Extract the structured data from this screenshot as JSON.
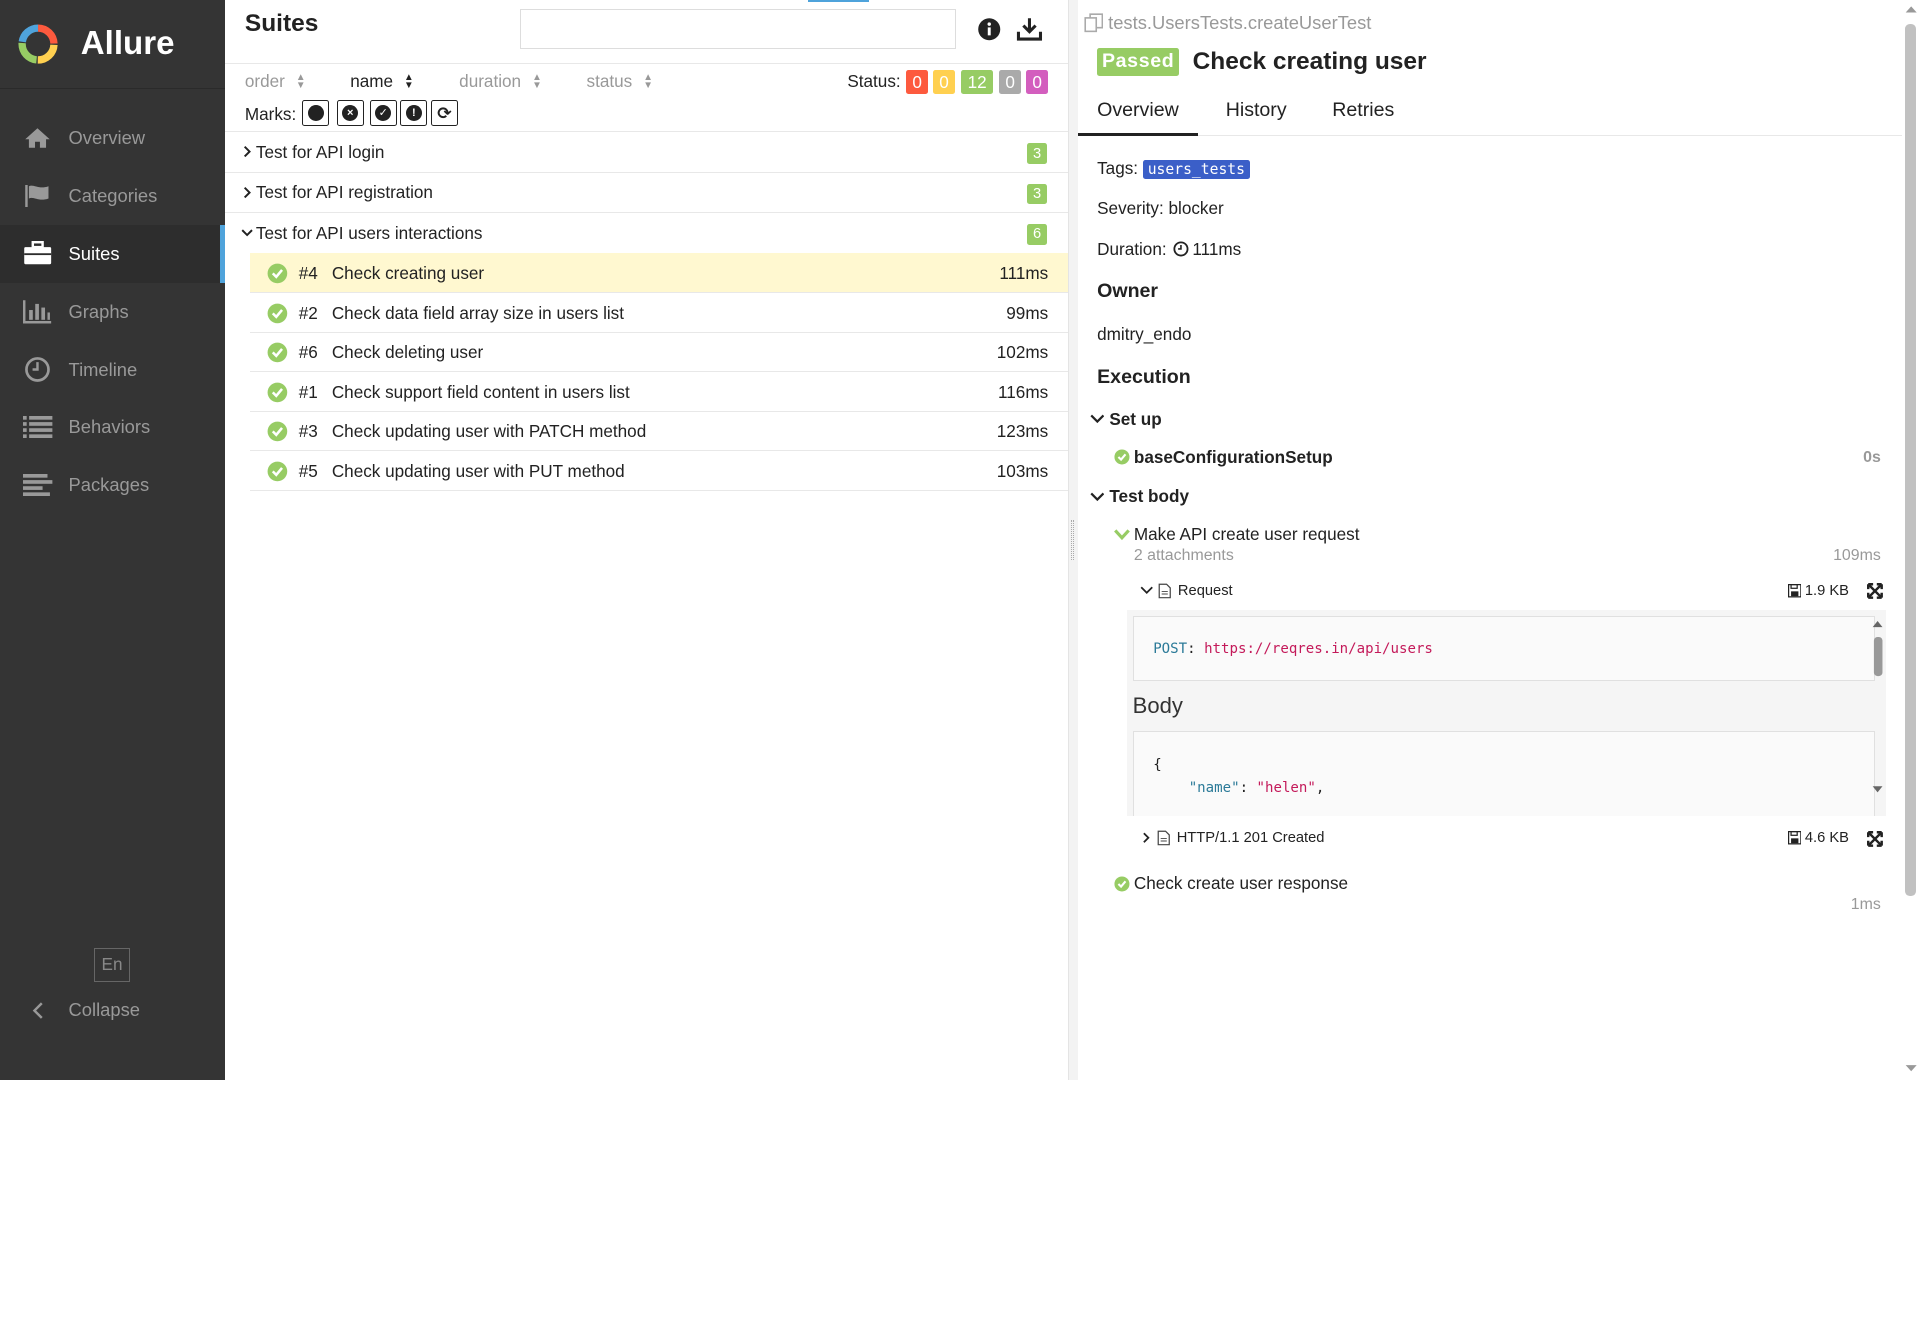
{
  "app": {
    "name": "Allure"
  },
  "sidebar": {
    "items": [
      {
        "label": "Overview",
        "icon": "home-icon"
      },
      {
        "label": "Categories",
        "icon": "flag-icon"
      },
      {
        "label": "Suites",
        "icon": "briefcase-icon",
        "active": true
      },
      {
        "label": "Graphs",
        "icon": "bar-chart-icon"
      },
      {
        "label": "Timeline",
        "icon": "clock-icon"
      },
      {
        "label": "Behaviors",
        "icon": "list-icon"
      },
      {
        "label": "Packages",
        "icon": "align-left-icon"
      }
    ],
    "language": "En",
    "collapse_label": "Collapse"
  },
  "suites": {
    "title": "Suites",
    "search_value": "",
    "sort": {
      "order": "order",
      "name": "name",
      "duration": "duration",
      "status": "status"
    },
    "status_label": "Status:",
    "status_counts": {
      "failed": "0",
      "broken": "0",
      "passed": "12",
      "skipped": "0",
      "unknown": "0"
    },
    "marks_label": "Marks:",
    "groups": [
      {
        "name": "Test for API login",
        "count": "3",
        "expanded": false
      },
      {
        "name": "Test for API registration",
        "count": "3",
        "expanded": false
      },
      {
        "name": "Test for API users interactions",
        "count": "6",
        "expanded": true
      }
    ],
    "tests": [
      {
        "num": "#4",
        "name": "Check creating user",
        "duration": "111ms",
        "selected": true
      },
      {
        "num": "#2",
        "name": "Check data field array size in users list",
        "duration": "99ms"
      },
      {
        "num": "#6",
        "name": "Check deleting user",
        "duration": "102ms"
      },
      {
        "num": "#1",
        "name": "Check support field content in users list",
        "duration": "116ms"
      },
      {
        "num": "#3",
        "name": "Check updating user with PATCH method",
        "duration": "123ms"
      },
      {
        "num": "#5",
        "name": "Check updating user with PUT method",
        "duration": "103ms"
      }
    ]
  },
  "detail": {
    "full_name": "tests.UsersTests.createUserTest",
    "status": "Passed",
    "title": "Check creating user",
    "tabs": [
      "Overview",
      "History",
      "Retries"
    ],
    "tags_label": "Tags:",
    "tag": "users_tests",
    "severity": "Severity: blocker",
    "duration_label": "Duration:",
    "duration": "111ms",
    "owner_heading": "Owner",
    "owner": "dmitry_endo",
    "execution_heading": "Execution",
    "setup_label": "Set up",
    "setup_step": "baseConfigurationSetup",
    "setup_duration": "0s",
    "body_label": "Test body",
    "step1": "Make API create user request",
    "step1_attachments": "2 attachments",
    "step1_duration": "109ms",
    "attachment1": {
      "name": "Request",
      "size": "1.9 KB"
    },
    "request": {
      "method": "POST",
      "url": "https://reqres.in/api/users"
    },
    "body_heading": "Body",
    "body_lines": [
      "{",
      "\"name\"",
      "\"helen\""
    ],
    "attachment2": {
      "name": "HTTP/1.1 201 Created",
      "size": "4.6 KB"
    },
    "step2": "Check create user response",
    "step2_duration": "1ms"
  },
  "colors": {
    "sidebar_bg": "#343434",
    "failed": "#fd5a3e",
    "broken": "#ffd050",
    "passed": "#97cc64",
    "skipped": "#aaaaaa",
    "unknown": "#d35ebe",
    "tag": "#3b5fc8",
    "selected_row": "#fff8d0"
  }
}
